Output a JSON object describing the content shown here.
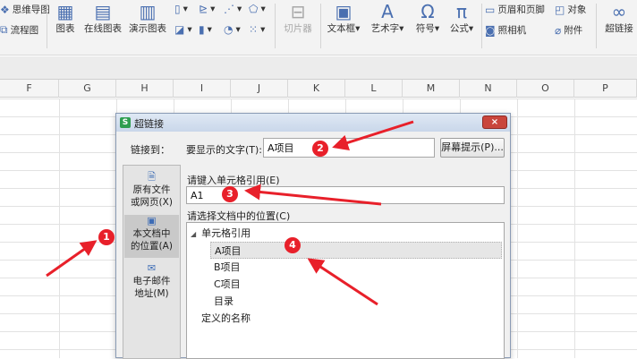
{
  "ribbon": {
    "row1": [
      "思维导图",
      "页眉和页脚",
      "对象"
    ],
    "row2": [
      "流程图",
      "图表",
      "在线图表",
      "演示图表",
      "切片器",
      "文本框",
      "艺术字",
      "符号",
      "公式",
      "照相机",
      "附件",
      "超链接"
    ],
    "icons": {
      "mindmap": "mindmap-icon",
      "flowchart": "flowchart-icon",
      "chart": "chart-icon",
      "online_chart": "online-chart-icon",
      "demo_chart": "demo-chart-icon",
      "slicer": "slicer-icon",
      "textbox": "textbox-icon",
      "wordart": "wordart-icon",
      "symbol": "omega-icon",
      "formula": "pi-icon",
      "header_footer": "header-footer-icon",
      "object": "object-icon",
      "camera": "camera-icon",
      "attachment": "paperclip-icon",
      "hyperlink": "link-icon"
    }
  },
  "columns": [
    "F",
    "G",
    "H",
    "I",
    "J",
    "K",
    "L",
    "M",
    "N",
    "O",
    "P"
  ],
  "dialog": {
    "title": "超链接",
    "close_glyph": "×",
    "link_to_label": "链接到：",
    "display_text_label": "要显示的文字(T):",
    "display_text_value": "A项目",
    "screen_tip_button": "屏幕提示(P)...",
    "cell_ref_label": "请键入单元格引用(E)",
    "cell_ref_value": "A1",
    "location_label": "请选择文档中的位置(C)",
    "sidebar": [
      {
        "line1": "原有文件",
        "line2": "或网页(X)",
        "icon": "file-web-icon"
      },
      {
        "line1": "本文档中",
        "line2": "的位置(A)",
        "icon": "document-place-icon"
      },
      {
        "line1": "电子邮件",
        "line2": "地址(M)",
        "icon": "email-icon"
      }
    ],
    "tree": {
      "root": "单元格引用",
      "expander": "◢",
      "children": [
        "A项目",
        "B项目",
        "C项目",
        "目录"
      ],
      "defined_names": "定义的名称"
    }
  },
  "annotations": [
    "1",
    "2",
    "3",
    "4"
  ],
  "colors": {
    "annotation_red": "#e8202a",
    "dialog_bg": "#f0f0f0",
    "ribbon_bg": "#f3f3f3"
  }
}
